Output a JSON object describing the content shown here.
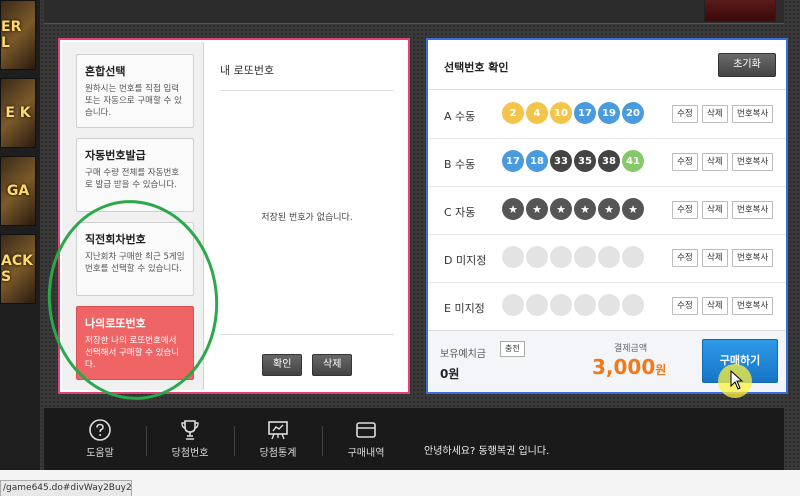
{
  "side_thumbs": [
    "ER L",
    "E K",
    "GA",
    "ACK S"
  ],
  "left": {
    "tabs": [
      {
        "title": "혼합선택",
        "desc": "원하시는 번호를 직접 입력 또는 자동으로 구매할 수 있습니다."
      },
      {
        "title": "자동번호발급",
        "desc": "구매 수량 전체를 자동번호로 발급 받을 수 있습니다."
      },
      {
        "title": "직전회차번호",
        "desc": "지난회차 구매한 최근 5게임 번호를 선택할 수 있습니다."
      },
      {
        "title": "나의로또번호",
        "desc": "저장한 나의 로또번호에서 선택해서 구매할 수 있습니다."
      }
    ],
    "mine_title": "내 로또번호",
    "empty_text": "저장된 번호가 없습니다.",
    "confirm_label": "확인",
    "delete_label": "삭제"
  },
  "right": {
    "title": "선택번호 확인",
    "reset_label": "초기화",
    "rows": [
      {
        "label": "A 수동",
        "balls": [
          {
            "n": "2",
            "c": "yellow"
          },
          {
            "n": "4",
            "c": "yellow"
          },
          {
            "n": "10",
            "c": "yellow"
          },
          {
            "n": "17",
            "c": "blue"
          },
          {
            "n": "19",
            "c": "blue"
          },
          {
            "n": "20",
            "c": "blue"
          }
        ]
      },
      {
        "label": "B 수동",
        "balls": [
          {
            "n": "17",
            "c": "blue"
          },
          {
            "n": "18",
            "c": "blue"
          },
          {
            "n": "33",
            "c": "dark"
          },
          {
            "n": "35",
            "c": "dark"
          },
          {
            "n": "38",
            "c": "dark"
          },
          {
            "n": "41",
            "c": "green"
          }
        ]
      },
      {
        "label": "C 자동",
        "balls": [
          {
            "n": "★",
            "c": "auto"
          },
          {
            "n": "★",
            "c": "auto"
          },
          {
            "n": "★",
            "c": "auto"
          },
          {
            "n": "★",
            "c": "auto"
          },
          {
            "n": "★",
            "c": "auto"
          },
          {
            "n": "★",
            "c": "auto"
          }
        ]
      },
      {
        "label": "D 미지정",
        "balls": [
          {
            "n": "",
            "c": "empty"
          },
          {
            "n": "",
            "c": "empty"
          },
          {
            "n": "",
            "c": "empty"
          },
          {
            "n": "",
            "c": "empty"
          },
          {
            "n": "",
            "c": "empty"
          },
          {
            "n": "",
            "c": "empty"
          }
        ]
      },
      {
        "label": "E 미지정",
        "balls": [
          {
            "n": "",
            "c": "empty"
          },
          {
            "n": "",
            "c": "empty"
          },
          {
            "n": "",
            "c": "empty"
          },
          {
            "n": "",
            "c": "empty"
          },
          {
            "n": "",
            "c": "empty"
          },
          {
            "n": "",
            "c": "empty"
          }
        ]
      }
    ],
    "edit_label": "수정",
    "remove_label": "삭제",
    "copy_label": "번호복사",
    "deposit_label": "보유예치금",
    "charge_label": "충전",
    "deposit_value": "0원",
    "pay_label": "결제금액",
    "pay_value": "3,000",
    "pay_unit": "원",
    "buy_label": "구매하기"
  },
  "bottom_nav": [
    {
      "label": "도움말",
      "icon": "help-icon"
    },
    {
      "label": "당첨번호",
      "icon": "trophy-icon"
    },
    {
      "label": "당첨통계",
      "icon": "chart-board-icon"
    },
    {
      "label": "구매내역",
      "icon": "card-icon"
    }
  ],
  "greeting": "안녕하세요? 동행복권 입니다.",
  "status_url": "/game645.do#divWay2Buy2",
  "colors": {
    "accent_pink": "#e0457a",
    "accent_blue": "#3a6fd8",
    "buy_blue": "#1775c8",
    "price_orange": "#f07a1a",
    "annotation_green": "#2aa84a"
  }
}
